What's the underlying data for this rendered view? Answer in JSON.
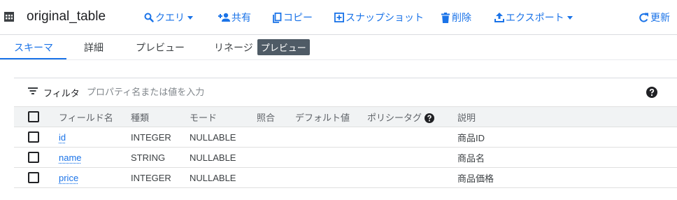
{
  "header": {
    "title": "original_table",
    "actions": {
      "query": "クエリ",
      "share": "共有",
      "copy": "コピー",
      "snapshot": "スナップショット",
      "delete": "削除",
      "export": "エクスポート",
      "refresh": "更新"
    }
  },
  "tabs": [
    {
      "label": "スキーマ"
    },
    {
      "label": "詳細"
    },
    {
      "label": "プレビュー"
    },
    {
      "label": "リネージ",
      "badge": "プレビュー"
    }
  ],
  "filter": {
    "label": "フィルタ",
    "placeholder": "プロパティ名または値を入力"
  },
  "schema": {
    "columns": [
      "フィールド名",
      "種類",
      "モード",
      "照合",
      "デフォルト値",
      "ポリシータグ",
      "説明"
    ],
    "rows": [
      {
        "name": "id",
        "type": "INTEGER",
        "mode": "NULLABLE",
        "collation": "",
        "default": "",
        "policy": "",
        "description": "商品ID"
      },
      {
        "name": "name",
        "type": "STRING",
        "mode": "NULLABLE",
        "collation": "",
        "default": "",
        "policy": "",
        "description": "商品名"
      },
      {
        "name": "price",
        "type": "INTEGER",
        "mode": "NULLABLE",
        "collation": "",
        "default": "",
        "policy": "",
        "description": "商品価格"
      }
    ]
  },
  "icons": {
    "table": "table-icon",
    "query": "search-icon",
    "share": "person-add-icon",
    "copy": "copy-icon",
    "snapshot": "add-box-icon",
    "delete": "trash-icon",
    "export": "upload-icon",
    "refresh": "refresh-icon",
    "filter": "filter-icon",
    "help": "help-icon"
  },
  "colors": {
    "accent": "#1a73e8",
    "badge": "#4f5b66",
    "header_bg": "#f1f3f4"
  }
}
